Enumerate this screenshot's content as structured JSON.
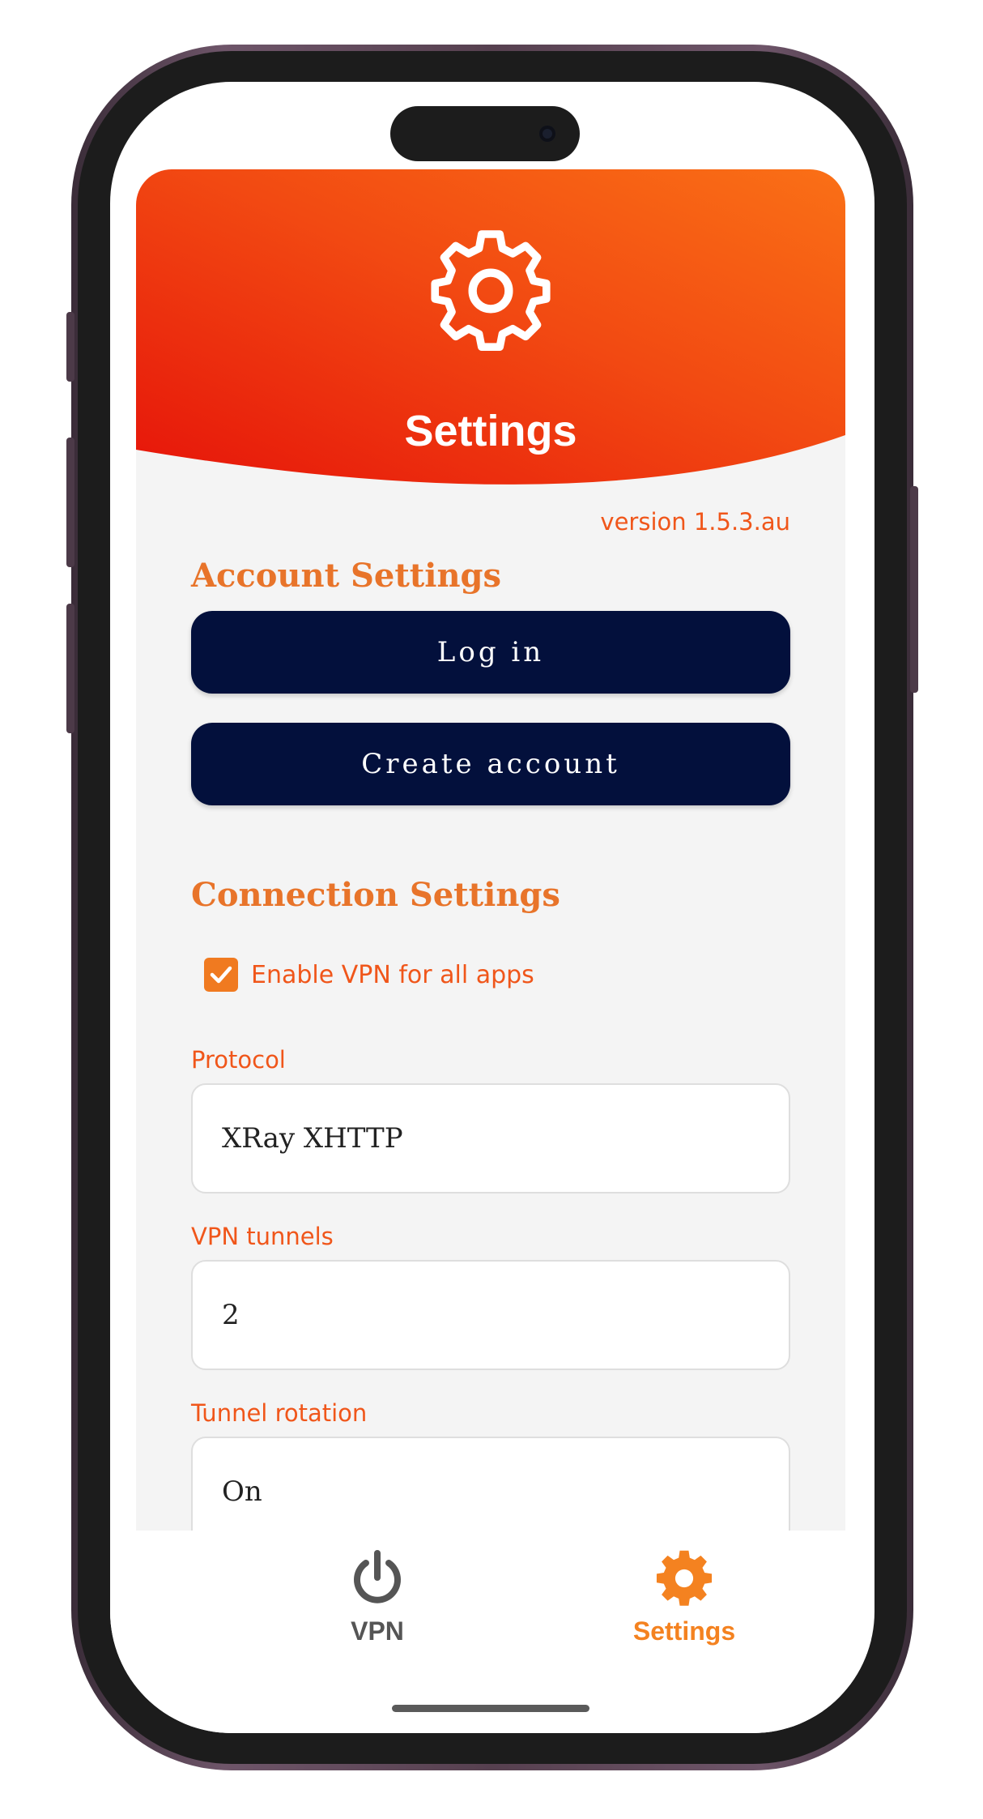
{
  "header": {
    "title": "Settings",
    "icon": "gear-icon",
    "gradient": [
      "#e8160a",
      "#f98b1a"
    ]
  },
  "version": "version 1.5.3.au",
  "account_settings": {
    "title": "Account Settings",
    "login_label": "Log in",
    "create_account_label": "Create account"
  },
  "connection_settings": {
    "title": "Connection Settings",
    "enable_vpn_all_apps": {
      "label": "Enable VPN for all apps",
      "checked": true
    },
    "protocol": {
      "label": "Protocol",
      "value": "XRay XHTTP"
    },
    "vpn_tunnels": {
      "label": "VPN tunnels",
      "value": "2"
    },
    "tunnel_rotation": {
      "label": "Tunnel rotation",
      "value": "On"
    }
  },
  "bottom_nav": {
    "items": [
      {
        "label": "VPN",
        "icon": "power-icon",
        "active": false,
        "color": "#555555"
      },
      {
        "label": "Settings",
        "icon": "gear-icon",
        "active": true,
        "color": "#f48220"
      }
    ]
  },
  "colors": {
    "accent": "#f0561a",
    "section_title": "#e8742a",
    "button_bg": "#03103c",
    "background": "#f4f4f4"
  }
}
